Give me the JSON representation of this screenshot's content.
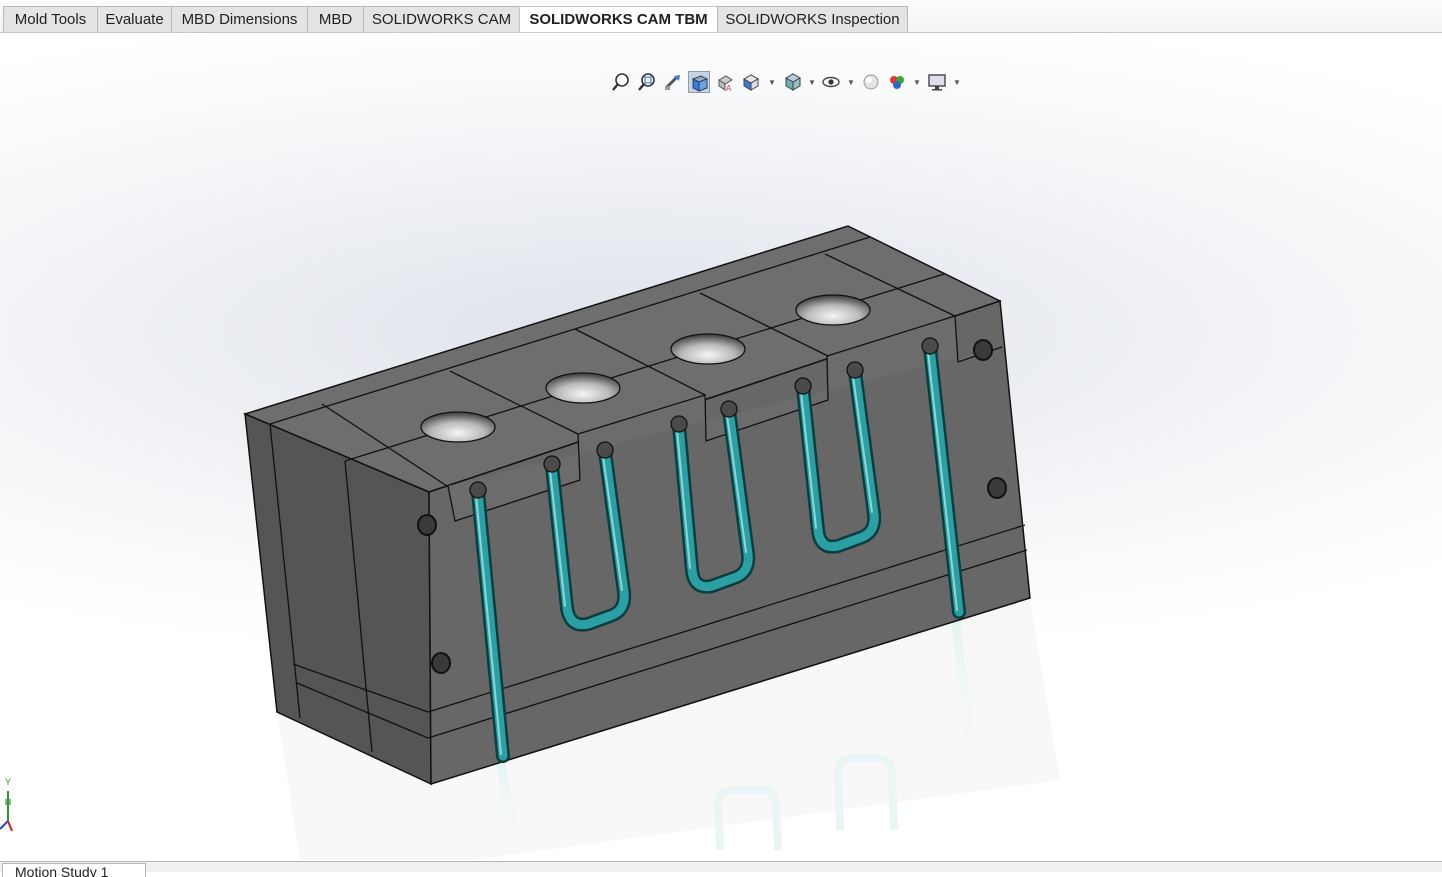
{
  "tabs": [
    {
      "label": "Mold Tools",
      "active": false
    },
    {
      "label": "Evaluate",
      "active": false
    },
    {
      "label": "MBD Dimensions",
      "active": false
    },
    {
      "label": "MBD",
      "active": false
    },
    {
      "label": "SOLIDWORKS CAM",
      "active": false
    },
    {
      "label": "SOLIDWORKS CAM TBM",
      "active": true
    },
    {
      "label": "SOLIDWORKS Inspection",
      "active": false
    }
  ],
  "heads_up_toolbar": [
    "zoom-to-fit-icon",
    "zoom-to-area-icon",
    "previous-view-icon",
    "section-view-icon",
    "dynamic-annotation-views-icon",
    "view-orientation-icon",
    "display-style-icon",
    "hide-show-items-icon",
    "edit-appearance-icon",
    "apply-scene-icon",
    "view-settings-icon"
  ],
  "triad": {
    "y_label": "Y"
  },
  "bottom_tabs": [
    {
      "label": "Motion Study 1"
    }
  ],
  "colors": {
    "mold_body": "#6b6b6b",
    "cooling_channel": "#2a9a9e",
    "active_tab": "#ffffff"
  }
}
